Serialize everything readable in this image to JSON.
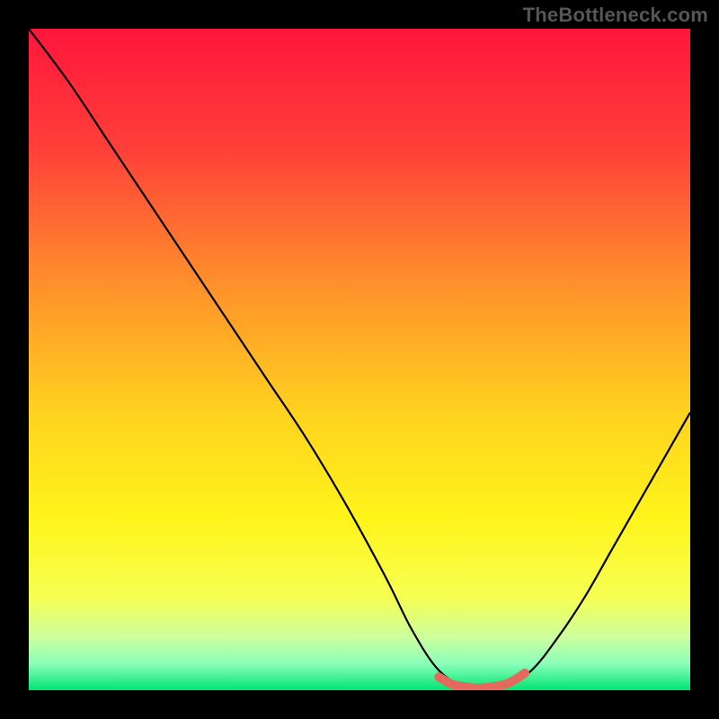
{
  "watermark": "TheBottleneck.com",
  "chart_data": {
    "type": "line",
    "title": "",
    "xlabel": "",
    "ylabel": "",
    "xlim": [
      0,
      100
    ],
    "ylim": [
      0,
      100
    ],
    "gradient_stops": [
      {
        "offset": 0,
        "color": "#ff163c"
      },
      {
        "offset": 18,
        "color": "#ff3f39"
      },
      {
        "offset": 38,
        "color": "#ff8e2b"
      },
      {
        "offset": 58,
        "color": "#ffd21f"
      },
      {
        "offset": 74,
        "color": "#fff41a"
      },
      {
        "offset": 86,
        "color": "#f6ff52"
      },
      {
        "offset": 92,
        "color": "#ccff9e"
      },
      {
        "offset": 96,
        "color": "#8bffba"
      },
      {
        "offset": 100,
        "color": "#00e472"
      }
    ],
    "series": [
      {
        "name": "bottleneck-curve",
        "color": "#000000",
        "x": [
          0,
          6,
          12,
          18,
          24,
          30,
          36,
          42,
          48,
          54,
          58,
          62,
          66,
          69,
          72,
          76,
          80,
          84,
          88,
          92,
          96,
          100
        ],
        "y": [
          100,
          92,
          83,
          74,
          65,
          56,
          47,
          38,
          28,
          17,
          9,
          3,
          0.5,
          0,
          0.5,
          3,
          8,
          14,
          21,
          28,
          35,
          42
        ]
      },
      {
        "name": "optimal-band",
        "color": "#e36a5c",
        "x": [
          62,
          64,
          66,
          68,
          70,
          72,
          73.5,
          75
        ],
        "y": [
          2.0,
          0.9,
          0.5,
          0.3,
          0.5,
          0.9,
          1.6,
          2.6
        ]
      }
    ]
  }
}
